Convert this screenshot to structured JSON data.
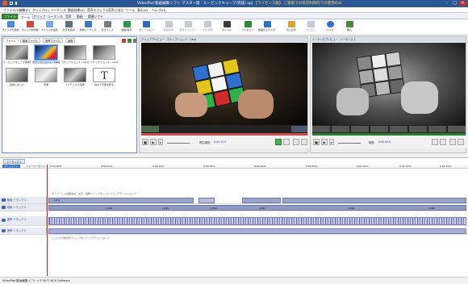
{
  "window": {
    "title": "VideoPad 動画編集ソフト マスター版 - ルービックキューブ(完成).vpj",
    "title_highlight": "【ライセンス版】 ご家庭での非営利目的での使用のみ",
    "controls": {
      "minimize": "–",
      "maximize": "□",
      "close": "✕"
    }
  },
  "menu": [
    "ファイル(F)",
    "編集(E)",
    "クリップ(C)",
    "シーケンス",
    "動画効果(V)",
    "音声エフェクト",
    "音声と出力",
    "ツール",
    "表示(V)",
    "ヘルプ(H)"
  ],
  "tabs": {
    "file": "ファイル",
    "items": [
      "ホーム",
      "クリップ",
      "シーケンス",
      "音声",
      "動画",
      "関連ソフト"
    ]
  },
  "ribbon": [
    "クリップを追加",
    "クリップを削除",
    "ファイルを追加",
    "文字を追加",
    "新規シーケンス",
    "空クリップ",
    "動画/音声",
    "ナレーション",
    "動画効果",
    "遷移エフェクト",
    "分割/切断",
    "タイトル",
    "プレビュー",
    "動画をエクスポート",
    "元に戻す",
    "やり直し",
    "ヘルプ",
    "購入"
  ],
  "bin": {
    "tabs": [
      "ファイル",
      "動画ファイル",
      "音声ファイル",
      "画像"
    ],
    "items": [
      {
        "label": "ルービックキューブ完成形.avi"
      },
      {
        "label": "スナップショット - Lang"
      },
      {
        "label": "スナップショット - Lang"
      },
      {
        "label": "スナップショット - Lang (ルービック)"
      },
      {
        "label": "完成しました"
      },
      {
        "label": "手順"
      },
      {
        "label": "7ステップで完成"
      },
      {
        "label": "白の十字架を作る"
      }
    ]
  },
  "clip_preview": {
    "header": "クリッププレビュー - スナップショット - Lang",
    "time_label": "再生時間:",
    "time": "0:00:12.0"
  },
  "seq_preview": {
    "header": "シーケンスプレビュー - シーケンス 1",
    "time_label": "時間:",
    "time": "0:00:00.0"
  },
  "timeline": {
    "sequence_tab": "シーケンス 1",
    "view_tabs": [
      "タイムライン",
      "ストーリーボード"
    ],
    "ruler": [
      "0:00:00.0",
      "0:00:10.0",
      "0:00:20.0",
      "0:00:30.0",
      "0:00:40.0",
      "0:00:50.0",
      "0:01:00.0",
      "0:01:10.0",
      "0:01:20.0"
    ],
    "overlay_hint": "オーバーレイ画面追加、文字、画像クリップをここにドラッグアンドドロップ",
    "audio_hint": "ここにその他音声クリップをドラッグアンドドロップ",
    "tracks": [
      {
        "name": "動画 トラック 1",
        "clip_label": "Lang"
      },
      {
        "name": "動画 トラック 2",
        "clip_label": "スナップショット"
      },
      {
        "name": "音声 トラック 1",
        "clip_label": "ルービック"
      },
      {
        "name": "音声 トラック 2",
        "clip_label": ""
      }
    ],
    "clip_text": "LANG"
  },
  "status": "VideoPad 動画編集ソフト v 3.38 © NCH Software"
}
